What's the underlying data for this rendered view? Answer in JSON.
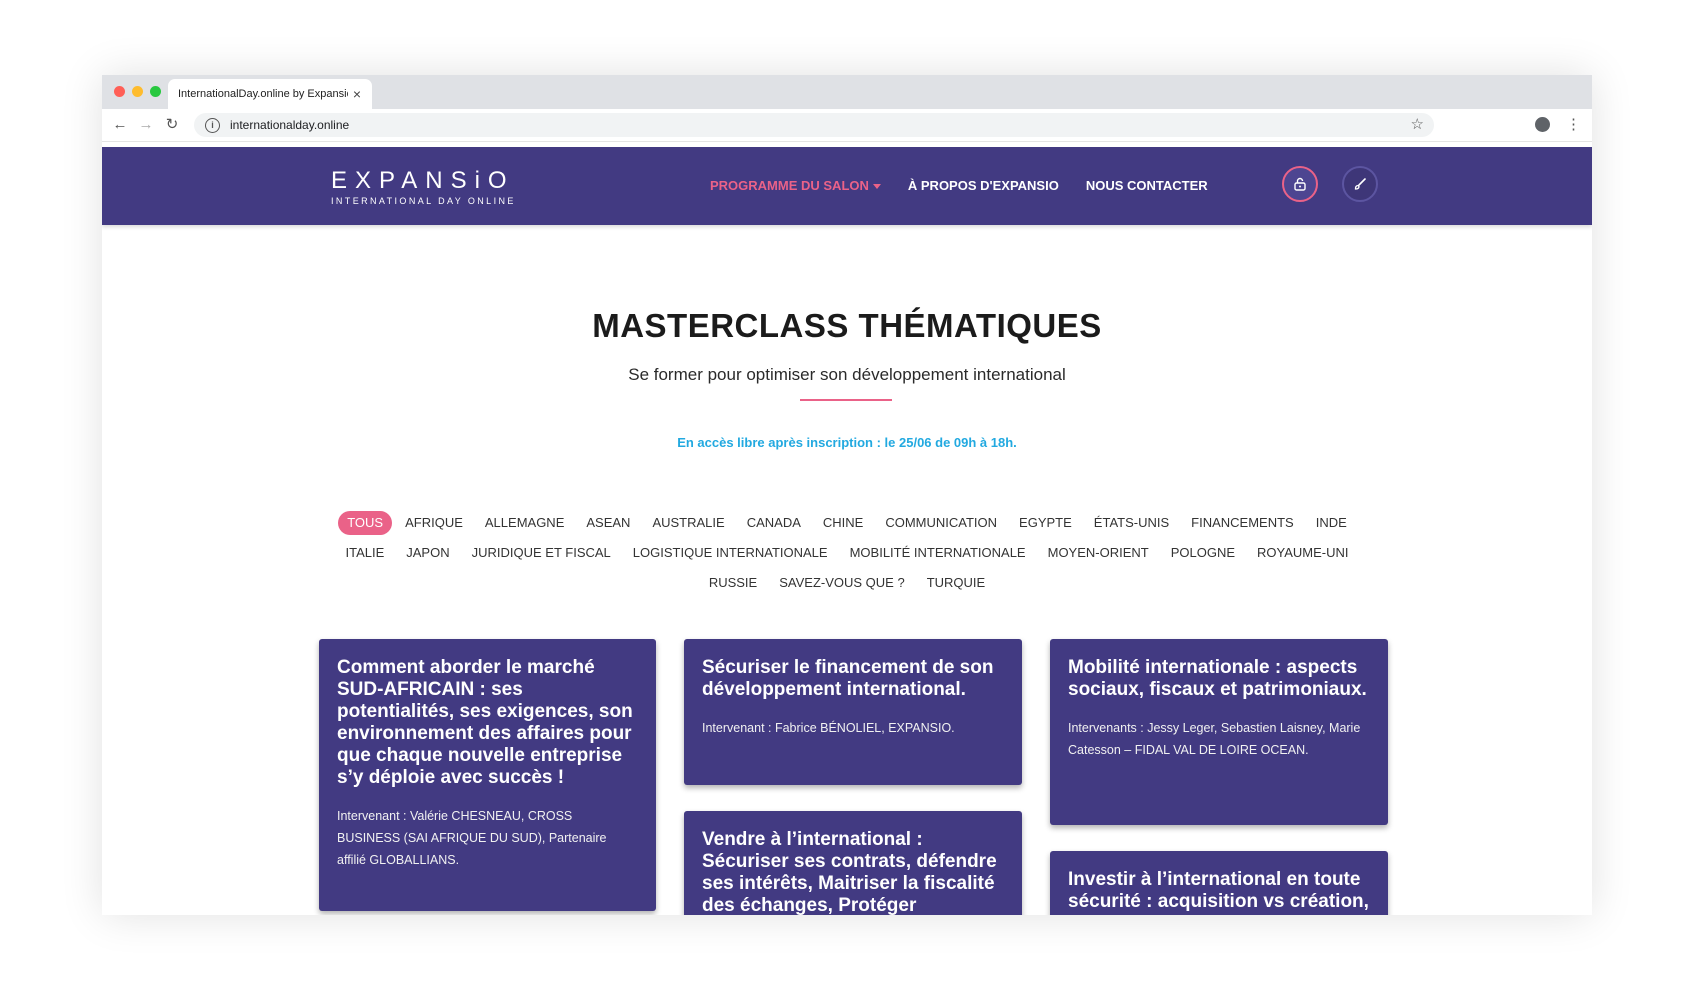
{
  "browser": {
    "tab_title": "InternationalDay.online by Expansio",
    "url": "internationalday.online",
    "traffic_lights": [
      "#ff5f57",
      "#febc2e",
      "#28c840"
    ]
  },
  "header": {
    "logo_main": "EXPANSiO",
    "logo_sub": "INTERNATIONAL DAY ONLINE",
    "nav": [
      {
        "label": "PROGRAMME DU SALON",
        "active": true
      },
      {
        "label": "À PROPOS D'EXPANSIO",
        "active": false
      },
      {
        "label": "NOUS CONTACTER",
        "active": false
      }
    ],
    "icons": [
      "lock-icon",
      "brush-icon"
    ]
  },
  "main": {
    "title": "MASTERCLASS THÉMATIQUES",
    "subtitle": "Se former pour optimiser son développement international",
    "access_note": "En accès libre après inscription : le 25/06 de 09h à 18h."
  },
  "filters": [
    "TOUS",
    "AFRIQUE",
    "ALLEMAGNE",
    "ASEAN",
    "AUSTRALIE",
    "CANADA",
    "CHINE",
    "COMMUNICATION",
    "EGYPTE",
    "ÉTATS-UNIS",
    "FINANCEMENTS",
    "INDE",
    "ITALIE",
    "JAPON",
    "JURIDIQUE ET FISCAL",
    "LOGISTIQUE INTERNATIONALE",
    "MOBILITÉ INTERNATIONALE",
    "MOYEN-ORIENT",
    "POLOGNE",
    "ROYAUME-UNI",
    "RUSSIE",
    "SAVEZ-VOUS QUE ?",
    "TURQUIE"
  ],
  "active_filter": "TOUS",
  "cards": [
    {
      "title": "Comment aborder le marché SUD-AFRICAIN : ses potentialités, ses exigences, son environnement des affaires pour que chaque nouvelle entreprise s’y déploie avec succès !",
      "speaker": "Intervenant : Valérie CHESNEAU, CROSS BUSINESS (SAI AFRIQUE DU SUD), Partenaire affilié GLOBALLIANS."
    },
    {
      "title": "Sécuriser le financement de son développement international.",
      "speaker": "Intervenant : Fabrice BÉNOLIEL, EXPANSIO."
    },
    {
      "title": "Mobilité internationale : aspects sociaux, fiscaux et patrimoniaux.",
      "speaker": "Intervenants : Jessy Leger, Sebastien Laisney, Marie Catesson – FIDAL VAL DE LOIRE OCEAN."
    },
    {
      "title": "Vendre à l’international : Sécuriser ses contrats, défendre ses intérêts, Maitriser la fiscalité des échanges, Protéger l’innovation et la PI.",
      "speaker": ""
    },
    {
      "title": "Investir à l’international en toute sécurité : acquisition vs création, process M&A, organisation des",
      "speaker": ""
    }
  ],
  "cart": {
    "count": "0"
  },
  "colors": {
    "brand": "#423a82",
    "accent": "#ea6288",
    "info": "#22a9e0"
  }
}
